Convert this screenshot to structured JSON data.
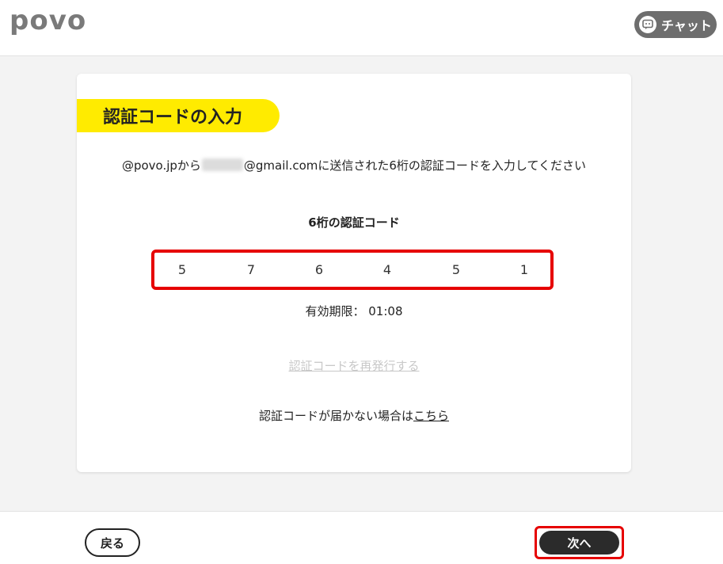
{
  "header": {
    "logo": "povo",
    "chat_label": "チャット"
  },
  "card": {
    "title": "認証コードの入力",
    "description_prefix": "@povo.jpから",
    "description_suffix": "@gmail.comに送信された6桁の認証コードを入力してください",
    "code_label": "6桁の認証コード",
    "code_digits": [
      "5",
      "7",
      "6",
      "4",
      "5",
      "1"
    ],
    "expiry": "有効期限： 01:08",
    "resend_link": "認証コードを再発行する",
    "help_prefix": "認証コードが届かない場合は",
    "help_link": "こちら"
  },
  "footer": {
    "back_label": "戻る",
    "next_label": "次へ"
  },
  "colors": {
    "accent_yellow": "#ffeb00",
    "highlight_red": "#e60000",
    "button_dark": "#2b2b2b"
  }
}
